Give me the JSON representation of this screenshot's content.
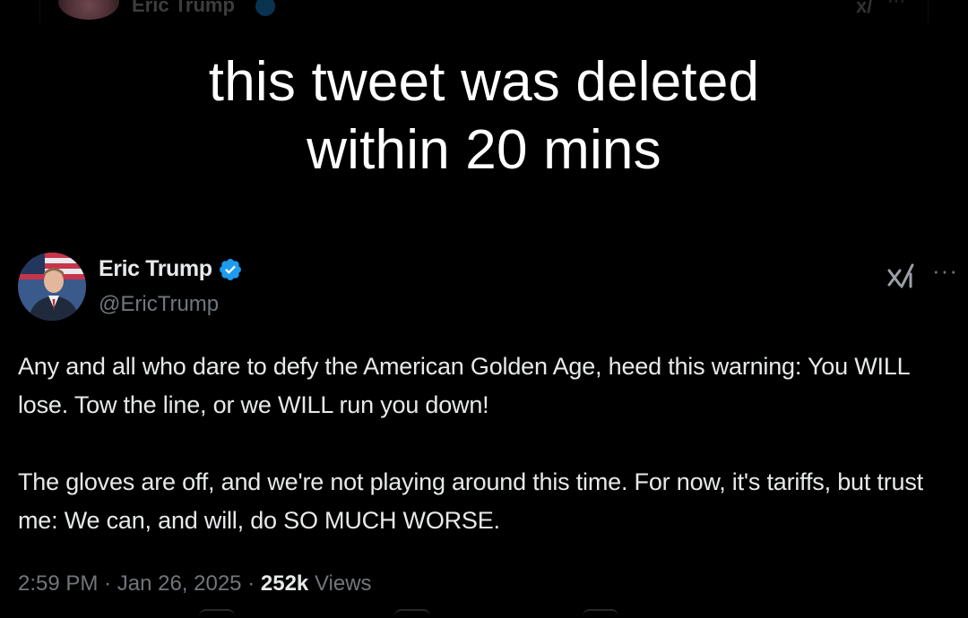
{
  "background_color": "#000000",
  "ghost_header": {
    "name": "Eric Trump",
    "icons": [
      "avatar",
      "verified-badge-icon",
      "grok-icon",
      "more-icon"
    ]
  },
  "caption": {
    "line1": "this tweet was deleted",
    "line2": "within 20 mins"
  },
  "tweet": {
    "display_name": "Eric Trump",
    "handle": "@EricTrump",
    "verified": true,
    "verified_color": "#1d9bf0",
    "paragraphs": [
      "Any and all who dare to defy the American Golden Age, heed this warning: You WILL lose. Tow the line, or we WILL run you down!",
      "The gloves are off, and we're not playing around this time. For now, it's tariffs, but trust me: We can, and will, do SO MUCH WORSE."
    ],
    "time": "2:59 PM",
    "date": "Jan 26, 2025",
    "views_count": "252k",
    "views_label": "Views",
    "separator": "·",
    "more_glyph": "···",
    "icons": [
      "avatar",
      "verified-badge-icon",
      "grok-icon",
      "more-icon"
    ]
  }
}
